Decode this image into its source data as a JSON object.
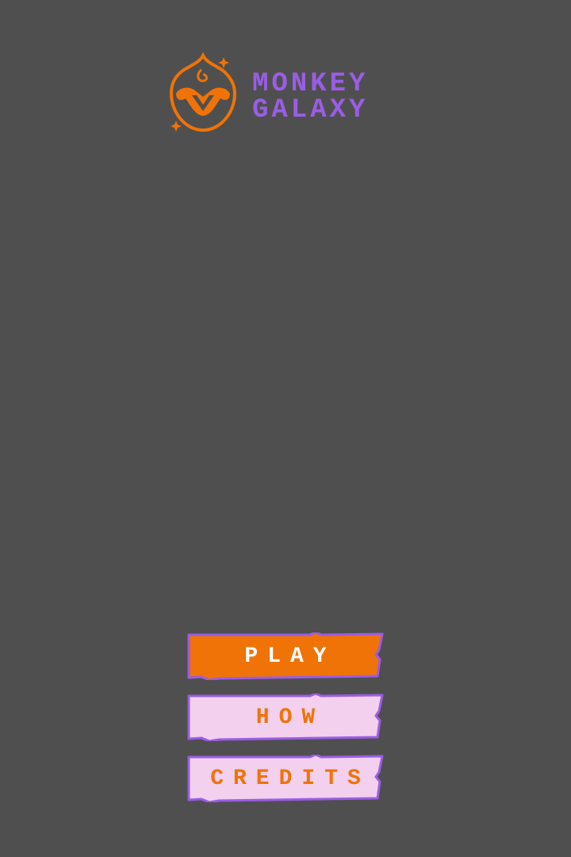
{
  "logo": {
    "icon": "monkey-face-icon",
    "line1": "MONKEY",
    "line2": "GALAXY"
  },
  "menu": {
    "play_label": "PLAY",
    "how_label": "HOW",
    "credits_label": "CREDITS"
  },
  "colors": {
    "background": "#4f4f4f",
    "brand_orange": "#f07307",
    "brand_purple": "#9b5de5",
    "button_light_fill": "#f2d0ee"
  }
}
